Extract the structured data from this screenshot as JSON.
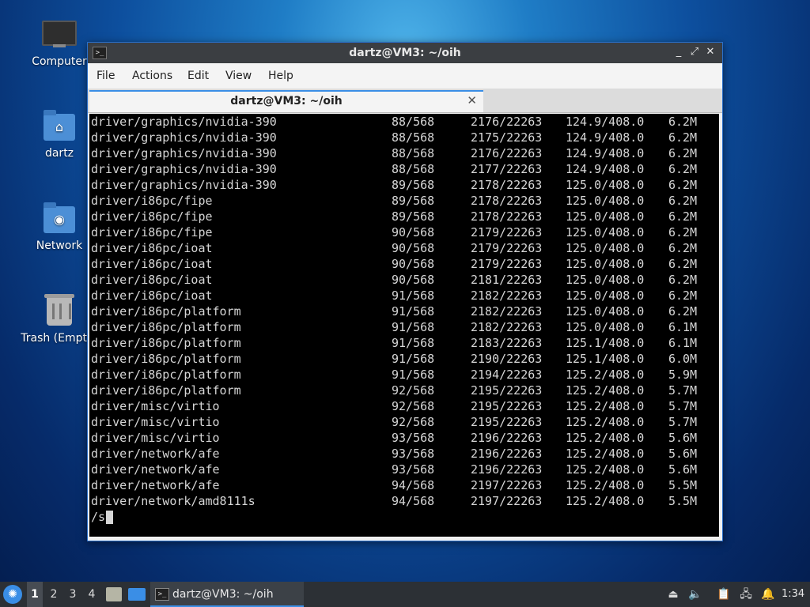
{
  "desktop": {
    "icons": [
      {
        "label": "Computer",
        "icon": "computer-icon"
      },
      {
        "label": "dartz",
        "icon": "home-folder-icon"
      },
      {
        "label": "Network",
        "icon": "network-folder-icon"
      },
      {
        "label": "Trash (Empty)",
        "icon": "trash-icon"
      }
    ]
  },
  "window": {
    "title": "dartz@VM3: ~/oih",
    "controls": {
      "minimize": "_",
      "maximize": "⤢",
      "close": "✕"
    },
    "menu": [
      "File",
      "Actions",
      "Edit",
      "View",
      "Help"
    ],
    "tab": {
      "title": "dartz@VM3: ~/oih",
      "close": "✕"
    }
  },
  "terminal": {
    "rows": [
      [
        "driver/graphics/nvidia-390",
        "88/568",
        "2176/22263",
        "124.9/408.0",
        "6.2M"
      ],
      [
        "driver/graphics/nvidia-390",
        "88/568",
        "2175/22263",
        "124.9/408.0",
        "6.2M"
      ],
      [
        "driver/graphics/nvidia-390",
        "88/568",
        "2176/22263",
        "124.9/408.0",
        "6.2M"
      ],
      [
        "driver/graphics/nvidia-390",
        "88/568",
        "2177/22263",
        "124.9/408.0",
        "6.2M"
      ],
      [
        "driver/graphics/nvidia-390",
        "89/568",
        "2178/22263",
        "125.0/408.0",
        "6.2M"
      ],
      [
        "driver/i86pc/fipe",
        "89/568",
        "2178/22263",
        "125.0/408.0",
        "6.2M"
      ],
      [
        "driver/i86pc/fipe",
        "89/568",
        "2178/22263",
        "125.0/408.0",
        "6.2M"
      ],
      [
        "driver/i86pc/fipe",
        "90/568",
        "2179/22263",
        "125.0/408.0",
        "6.2M"
      ],
      [
        "driver/i86pc/ioat",
        "90/568",
        "2179/22263",
        "125.0/408.0",
        "6.2M"
      ],
      [
        "driver/i86pc/ioat",
        "90/568",
        "2179/22263",
        "125.0/408.0",
        "6.2M"
      ],
      [
        "driver/i86pc/ioat",
        "90/568",
        "2181/22263",
        "125.0/408.0",
        "6.2M"
      ],
      [
        "driver/i86pc/ioat",
        "91/568",
        "2182/22263",
        "125.0/408.0",
        "6.2M"
      ],
      [
        "driver/i86pc/platform",
        "91/568",
        "2182/22263",
        "125.0/408.0",
        "6.2M"
      ],
      [
        "driver/i86pc/platform",
        "91/568",
        "2182/22263",
        "125.0/408.0",
        "6.1M"
      ],
      [
        "driver/i86pc/platform",
        "91/568",
        "2183/22263",
        "125.1/408.0",
        "6.1M"
      ],
      [
        "driver/i86pc/platform",
        "91/568",
        "2190/22263",
        "125.1/408.0",
        "6.0M"
      ],
      [
        "driver/i86pc/platform",
        "91/568",
        "2194/22263",
        "125.2/408.0",
        "5.9M"
      ],
      [
        "driver/i86pc/platform",
        "92/568",
        "2195/22263",
        "125.2/408.0",
        "5.7M"
      ],
      [
        "driver/misc/virtio",
        "92/568",
        "2195/22263",
        "125.2/408.0",
        "5.7M"
      ],
      [
        "driver/misc/virtio",
        "92/568",
        "2195/22263",
        "125.2/408.0",
        "5.7M"
      ],
      [
        "driver/misc/virtio",
        "93/568",
        "2196/22263",
        "125.2/408.0",
        "5.6M"
      ],
      [
        "driver/network/afe",
        "93/568",
        "2196/22263",
        "125.2/408.0",
        "5.6M"
      ],
      [
        "driver/network/afe",
        "93/568",
        "2196/22263",
        "125.2/408.0",
        "5.6M"
      ],
      [
        "driver/network/afe",
        "94/568",
        "2197/22263",
        "125.2/408.0",
        "5.5M"
      ],
      [
        "driver/network/amd8111s",
        "94/568",
        "2197/22263",
        "125.2/408.0",
        "5.5M"
      ]
    ],
    "prompt": "/s"
  },
  "taskbar": {
    "start_icon": "start-menu-icon",
    "workspaces": [
      "1",
      "2",
      "3",
      "4"
    ],
    "active_workspace": "1",
    "task_label": "dartz@VM3: ~/oih",
    "tray_icons": [
      "eject-icon",
      "volume-icon",
      "clipboard-icon",
      "network-icon",
      "notification-icon"
    ],
    "clock": "1:34"
  },
  "colors": {
    "accent": "#3a8ee6",
    "terminal_bg": "#000000",
    "terminal_fg": "#d6d6d6",
    "titlebar": "#3b3e42"
  }
}
